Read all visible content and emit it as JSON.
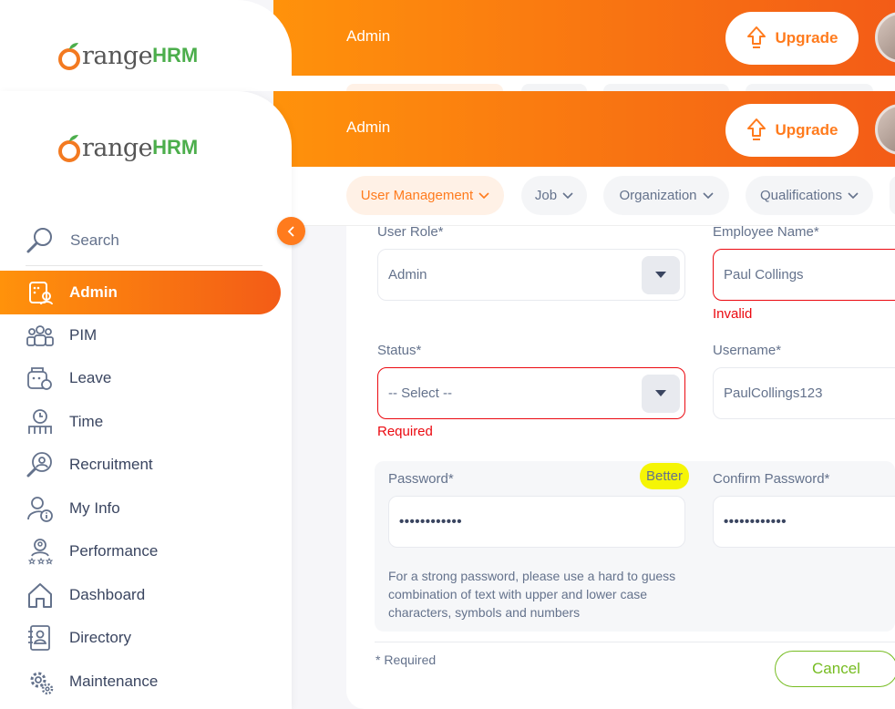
{
  "app": {
    "logo_word": "range",
    "logo_suffix": "HRM",
    "header_title": "Admin",
    "upgrade_label": "Upgrade"
  },
  "sidebar": {
    "search_label": "Search",
    "items": [
      {
        "label": "Admin",
        "icon": "admin-icon",
        "active": true
      },
      {
        "label": "PIM",
        "icon": "pim-icon"
      },
      {
        "label": "Leave",
        "icon": "leave-icon"
      },
      {
        "label": "Time",
        "icon": "time-icon"
      },
      {
        "label": "Recruitment",
        "icon": "recruitment-icon"
      },
      {
        "label": "My Info",
        "icon": "my-info-icon"
      },
      {
        "label": "Performance",
        "icon": "performance-icon"
      },
      {
        "label": "Dashboard",
        "icon": "dashboard-icon"
      },
      {
        "label": "Directory",
        "icon": "directory-icon"
      },
      {
        "label": "Maintenance",
        "icon": "maintenance-icon"
      }
    ]
  },
  "tabs": [
    {
      "label": "User Management",
      "active": true
    },
    {
      "label": "Job"
    },
    {
      "label": "Organization"
    },
    {
      "label": "Qualifications"
    }
  ],
  "form": {
    "user_role": {
      "label": "User Role*",
      "value": "Admin"
    },
    "employee_name": {
      "label": "Employee Name*",
      "value": "Paul Collings",
      "error": "Invalid"
    },
    "status": {
      "label": "Status*",
      "value": "-- Select --",
      "error": "Required"
    },
    "username": {
      "label": "Username*",
      "value": "PaulCollings123"
    },
    "password": {
      "label": "Password*",
      "value": "••••••••••••",
      "strength": "Better"
    },
    "confirm_password": {
      "label": "Confirm Password*",
      "value": "••••••••••••"
    },
    "hint": "For a strong password, please use a hard to guess combination of text with upper and lower case characters, symbols and numbers",
    "required_note": "* Required",
    "cancel_label": "Cancel"
  },
  "colors": {
    "brand_orange": "#ff7b1d",
    "error_red": "#eb0910",
    "accent_green": "#76bc21",
    "strength_yellow": "#f5f505"
  }
}
